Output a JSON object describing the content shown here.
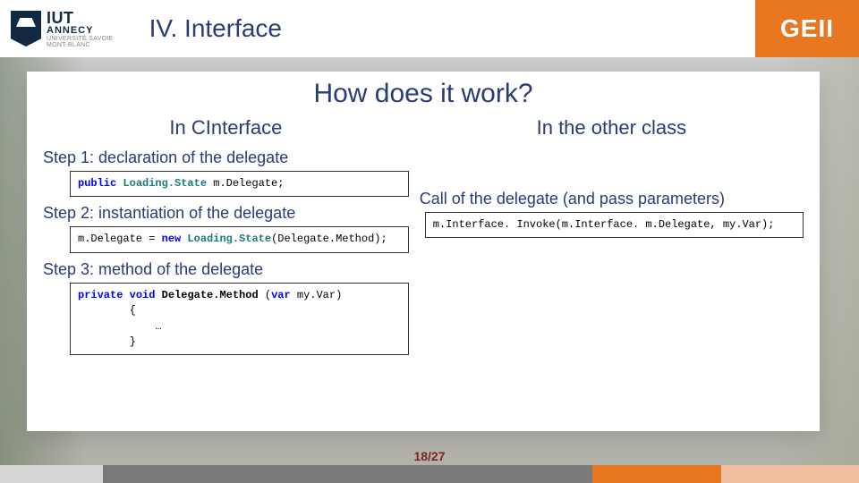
{
  "logo": {
    "line1": "IUT",
    "line2": "ANNECY",
    "line3": "UNIVERSITÉ SAVOIE",
    "line4": "MONT BLANC"
  },
  "header": {
    "section_title": "IV. Interface",
    "badge": "GEII"
  },
  "main": {
    "title": "How does it work?",
    "left": {
      "heading": "In CInterface",
      "step1_label": "Step 1: declaration of the delegate",
      "step2_label": "Step 2: instantiation of the delegate",
      "step3_label": "Step 3: method of the delegate",
      "code1": {
        "kw_public": "public",
        "type": "Loading.State",
        "rest": " m.Delegate;"
      },
      "code2": {
        "lhs": "m.Delegate = ",
        "kw_new": "new",
        "type": " Loading.State",
        "rest": "(Delegate.Method);"
      },
      "code3": {
        "kw_private": "private",
        "kw_void": " void",
        "method": " Delegate.Method ",
        "paren_open": "(",
        "kw_var": "var",
        "param": " my.Var)",
        "brace_open": "        {",
        "body": "            …",
        "brace_close": "        }"
      }
    },
    "right": {
      "heading": "In the other class",
      "call_label": "Call of the delegate (and pass parameters)",
      "code": "m.Interface. Invoke(m.Interface. m.Delegate, my.Var);"
    }
  },
  "page": {
    "indicator": "18/27"
  },
  "progress": {
    "segments": [
      {
        "cls": "prog-light",
        "pct": 12
      },
      {
        "cls": "prog-dark",
        "pct": 57
      },
      {
        "cls": "prog-orange",
        "pct": 15
      },
      {
        "cls": "prog-orange-light",
        "pct": 16
      }
    ]
  }
}
